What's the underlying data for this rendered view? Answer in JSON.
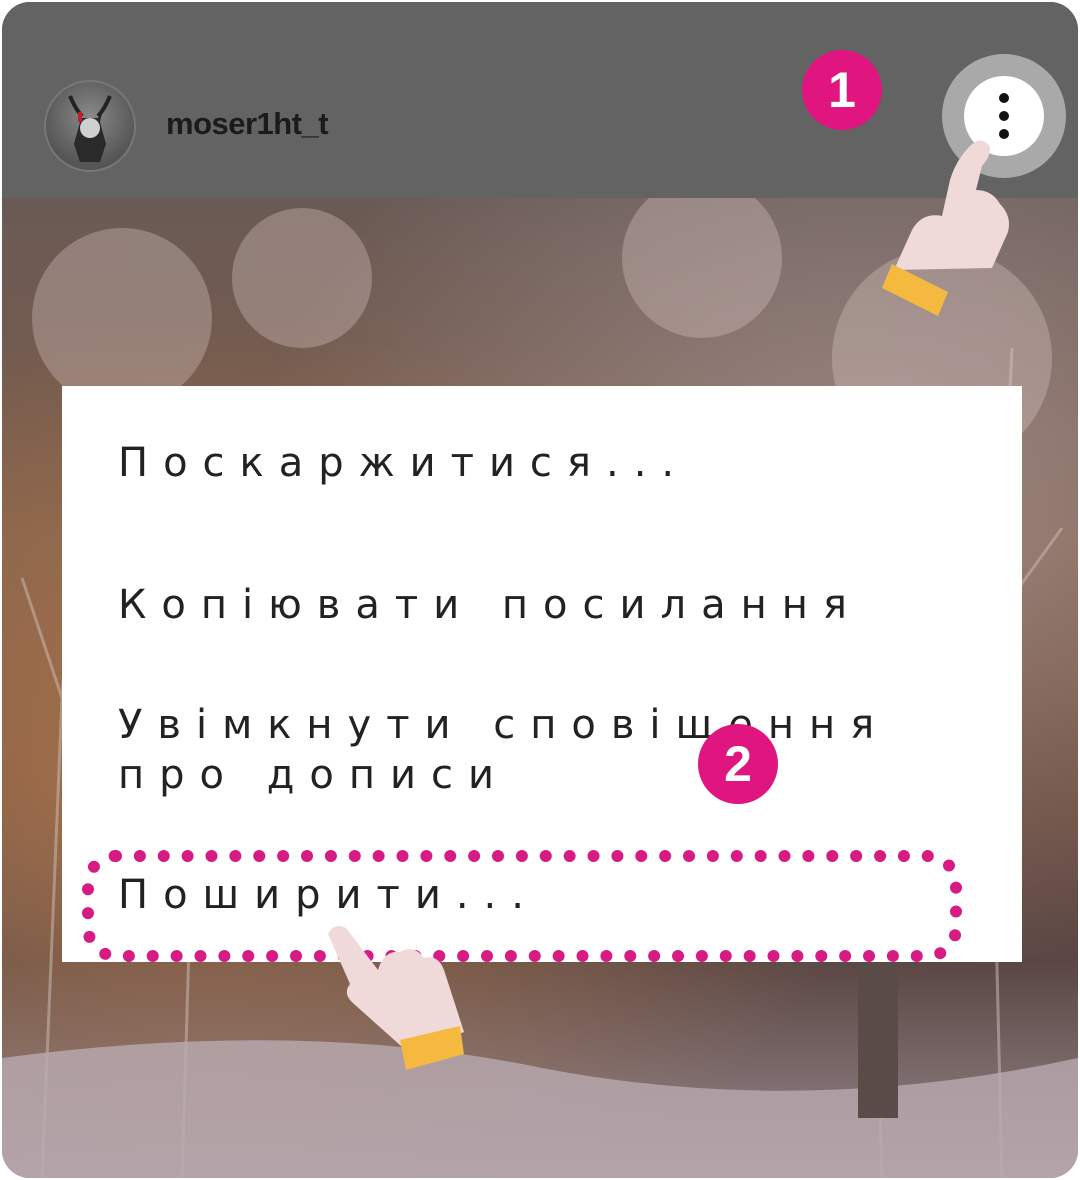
{
  "header": {
    "username": "moser1ht_t",
    "step1_badge": "1",
    "menu_button_icon": "three-dots-vertical-icon"
  },
  "menu": {
    "items": [
      {
        "label": "Поскаржитися..."
      },
      {
        "label": "Копіювати посилання"
      },
      {
        "label": "Увімкнути сповіщення\nпро дописи"
      },
      {
        "label": "Поширити..."
      }
    ],
    "step2_badge": "2"
  },
  "colors": {
    "accent": "#e0157f",
    "highlight_dots": "#d61b84",
    "header_bg": "#646363",
    "hand_cuff": "#f5b93f",
    "hand_skin": "#efd9d9"
  }
}
